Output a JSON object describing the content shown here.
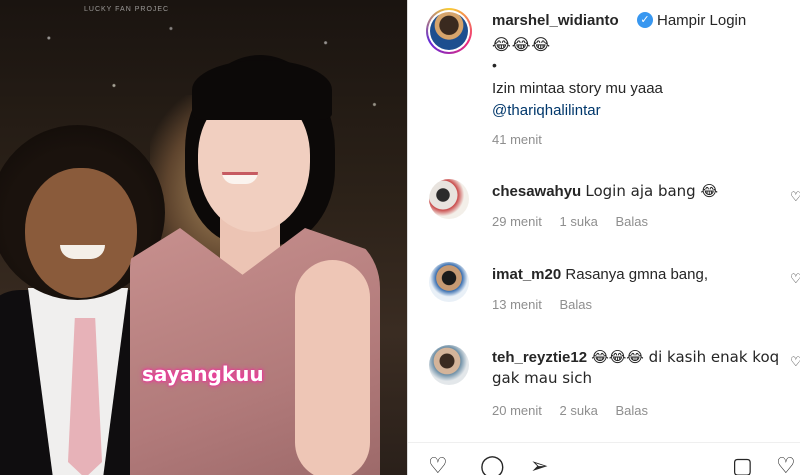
{
  "media": {
    "watermark": "LUCKY FAN PROJEC",
    "sticker_text": "sayangkuu"
  },
  "post": {
    "author": {
      "username": "marshel_widianto",
      "verified": true,
      "avatar_icon": "profile-avatar"
    },
    "caption": {
      "text": "Hampir Login",
      "emojis": "😂😂😂",
      "dot": "•",
      "line": "Izin mintaa story mu yaaa",
      "mention": "@thariqhalilintar",
      "time": "41 menit"
    }
  },
  "comments": [
    {
      "username": "chesawahyu",
      "text": "Login aja bang 😂",
      "time": "29 menit",
      "likes": "1 suka",
      "reply": "Balas"
    },
    {
      "username": "imat_m20",
      "text": "Rasanya gmna bang,",
      "time": "13 menit",
      "likes": "",
      "reply": "Balas"
    },
    {
      "username": "teh_reyztie12",
      "text": "😂😂😂 di kasih enak koq gak mau sich",
      "time": "20 menit",
      "likes": "2 suka",
      "reply": "Balas"
    }
  ],
  "icons": {
    "like": "heart-icon",
    "comment": "comment-icon",
    "share": "send-icon",
    "save": "bookmark-icon",
    "comment_like": "heart-outline-icon"
  },
  "colors": {
    "verified": "#3897f0",
    "mention": "#00376b",
    "muted": "#8e8e8e"
  }
}
